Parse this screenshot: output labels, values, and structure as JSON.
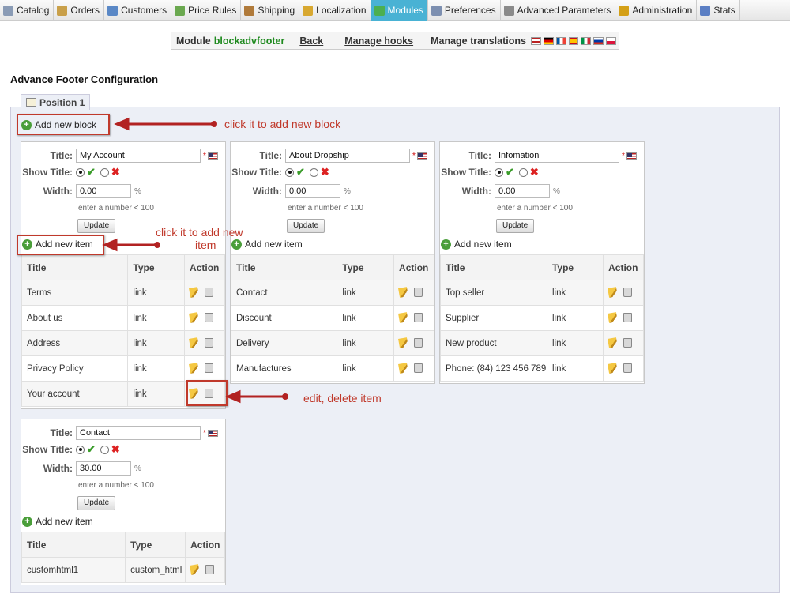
{
  "nav": {
    "tabs": [
      {
        "label": "Catalog",
        "icon": "catalog-icon"
      },
      {
        "label": "Orders",
        "icon": "orders-icon"
      },
      {
        "label": "Customers",
        "icon": "customers-icon"
      },
      {
        "label": "Price Rules",
        "icon": "price-rules-icon"
      },
      {
        "label": "Shipping",
        "icon": "shipping-icon"
      },
      {
        "label": "Localization",
        "icon": "localization-icon"
      },
      {
        "label": "Modules",
        "icon": "modules-icon"
      },
      {
        "label": "Preferences",
        "icon": "preferences-icon"
      },
      {
        "label": "Advanced Parameters",
        "icon": "advanced-icon"
      },
      {
        "label": "Administration",
        "icon": "administration-icon"
      },
      {
        "label": "Stats",
        "icon": "stats-icon"
      }
    ],
    "active": "Modules",
    "active_color": "#49b2d4"
  },
  "module_bar": {
    "module_prefix": "Module",
    "module_name": "blockadvfooter",
    "back": "Back",
    "manage_hooks": "Manage hooks",
    "manage_translations": "Manage translations",
    "flags": [
      "en",
      "de",
      "fr",
      "es",
      "it",
      "ru",
      "pl"
    ]
  },
  "page": {
    "heading": "Advance Footer Configuration",
    "position_tab": "Position 1",
    "add_new_block": "Add new block"
  },
  "labels": {
    "title": "Title:",
    "show_title": "Show Title:",
    "width": "Width:",
    "percent": "%",
    "hint": "enter a number < 100",
    "update": "Update",
    "add_new_item": "Add new item",
    "col_title": "Title",
    "col_type": "Type",
    "col_action": "Action",
    "required_mark": "*"
  },
  "blocks": [
    {
      "title": "My Account",
      "show_title": true,
      "width": "0.00",
      "items": [
        {
          "title": "Terms",
          "type": "link"
        },
        {
          "title": "About us",
          "type": "link"
        },
        {
          "title": "Address",
          "type": "link"
        },
        {
          "title": "Privacy Policy",
          "type": "link"
        },
        {
          "title": "Your account",
          "type": "link"
        }
      ]
    },
    {
      "title": "About Dropship",
      "show_title": true,
      "width": "0.00",
      "items": [
        {
          "title": "Contact",
          "type": "link"
        },
        {
          "title": "Discount",
          "type": "link"
        },
        {
          "title": "Delivery",
          "type": "link"
        },
        {
          "title": "Manufactures",
          "type": "link"
        }
      ]
    },
    {
      "title": "Infomation",
      "show_title": true,
      "width": "0.00",
      "items": [
        {
          "title": "Top seller",
          "type": "link"
        },
        {
          "title": "Supplier",
          "type": "link"
        },
        {
          "title": "New product",
          "type": "link"
        },
        {
          "title": "Phone: (84) 123 456 789",
          "type": "link"
        }
      ]
    },
    {
      "title": "Contact",
      "show_title": true,
      "width": "30.00",
      "items": [
        {
          "title": "customhtml1",
          "type": "custom_html"
        }
      ]
    }
  ],
  "annotations": {
    "add_block": "click it to add new block",
    "add_item_line1": "click it to add new",
    "add_item_line2": "item",
    "edit_delete": "edit, delete item",
    "color": "#c0392b"
  }
}
